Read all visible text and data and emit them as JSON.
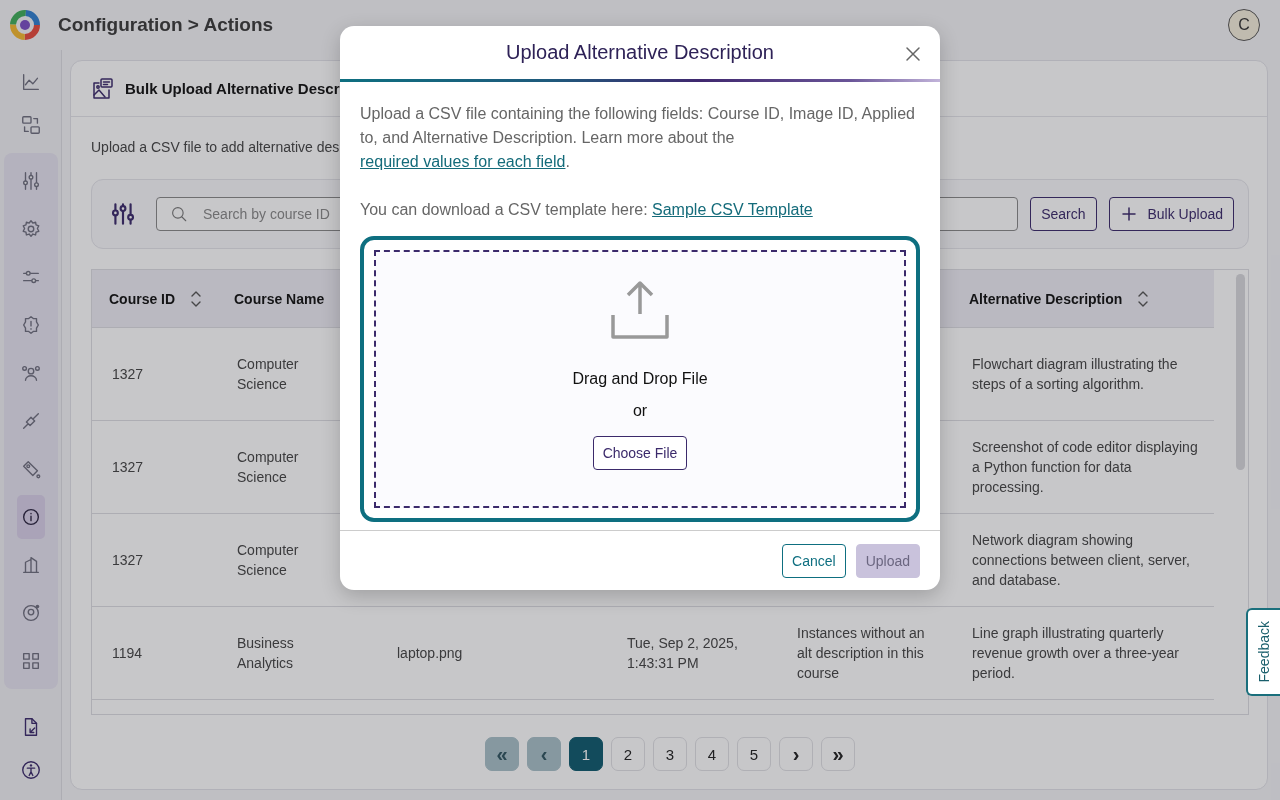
{
  "header": {
    "breadcrumb": "Configuration > Actions",
    "avatar": "C"
  },
  "sidebar": {
    "items": [
      {
        "kind": "top",
        "selected": false
      },
      {
        "kind": "top",
        "selected": false
      },
      {
        "kind": "group",
        "selected": false
      },
      {
        "kind": "group",
        "selected": false
      },
      {
        "kind": "group",
        "selected": false
      },
      {
        "kind": "group",
        "selected": false
      },
      {
        "kind": "group",
        "selected": false
      },
      {
        "kind": "group",
        "selected": false
      },
      {
        "kind": "group",
        "selected": false
      },
      {
        "kind": "group",
        "selected": true
      },
      {
        "kind": "group",
        "selected": false
      },
      {
        "kind": "group",
        "selected": false
      },
      {
        "kind": "group",
        "selected": false
      },
      {
        "kind": "bottom",
        "selected": false
      },
      {
        "kind": "bottom",
        "selected": false
      }
    ]
  },
  "card": {
    "title": "Bulk Upload Alternative Descr",
    "description": "Upload a CSV file to add alternative des",
    "filter_bar": {
      "search_placeholder": "Search by course ID",
      "search_button": "Search",
      "bulk_upload_button": "Bulk Upload"
    },
    "table": {
      "columns": [
        "Course ID",
        "Course Name",
        "Alternative Description"
      ],
      "rows": [
        {
          "course_id": "1327",
          "course_name": "Computer Science",
          "alternative_description": "Flowchart diagram illustrating the steps of a sorting algorithm."
        },
        {
          "course_id": "1327",
          "course_name": "Computer Science",
          "alternative_description": "Screenshot of code editor displaying a Python function for data processing."
        },
        {
          "course_id": "1327",
          "course_name": "Computer Science",
          "alternative_description": "Network diagram showing connections between client, server, and database."
        },
        {
          "course_id": "1194",
          "course_name": "Business Analytics",
          "column_3": "laptop.png",
          "column_4": "Tue, Sep 2, 2025, 1:43:31 PM",
          "column_5": "Instances without an alt description in this course",
          "alternative_description": "Line graph illustrating quarterly revenue growth over a three-year period."
        }
      ]
    },
    "pagination": [
      {
        "kind": "nav",
        "label": "«",
        "disabled": true
      },
      {
        "kind": "nav",
        "label": "‹",
        "disabled": true
      },
      {
        "kind": "page",
        "label": "1",
        "selected": true
      },
      {
        "kind": "page",
        "label": "2",
        "selected": false
      },
      {
        "kind": "page",
        "label": "3",
        "selected": false
      },
      {
        "kind": "page",
        "label": "4",
        "selected": false
      },
      {
        "kind": "page",
        "label": "5",
        "selected": false
      },
      {
        "kind": "nav",
        "label": "›",
        "disabled": false
      },
      {
        "kind": "nav",
        "label": "»",
        "disabled": false
      }
    ]
  },
  "feedback_tab": "Feedback",
  "modal": {
    "title": "Upload Alternative Description",
    "intro": "Upload a CSV file containing the following fields: Course ID, Image ID, Applied to, and Alternative Description. Learn more about the ",
    "intro_link": "required values for each field",
    "intro_end": ".",
    "template_text": "You can download a CSV template here: ",
    "template_link": "Sample CSV Template",
    "dropzone": {
      "prompt": "Drag and Drop File",
      "separator": "or",
      "choose_button": "Choose File"
    },
    "buttons": [
      {
        "kind": "cancel",
        "label": "Cancel",
        "disabled": false
      },
      {
        "kind": "upload",
        "label": "Upload",
        "disabled": true
      }
    ]
  }
}
